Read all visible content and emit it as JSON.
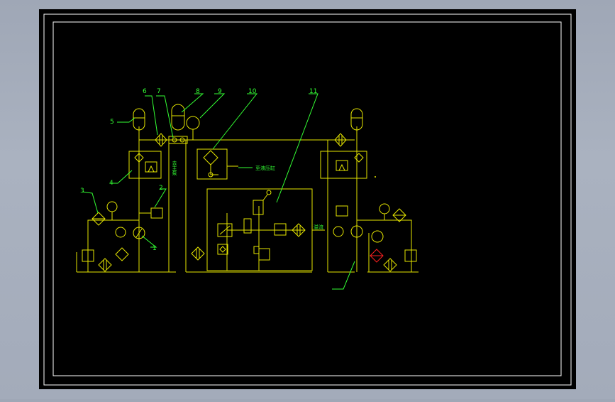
{
  "drawing": {
    "colors": {
      "viewport_bg": "#9fa7b6",
      "paper": "#000000",
      "frame": "#ffffff",
      "line_yellow": "#e6e600",
      "line_green": "#33ff33",
      "annotation": "#33ff33",
      "red_component": "#ff2020"
    },
    "balloon_labels": [
      "1",
      "2",
      "3",
      "4",
      "5",
      "6",
      "7",
      "8",
      "9",
      "10",
      "11"
    ],
    "text_notes": {
      "left_vertical": "去主泵",
      "mid_right": "至液压缸",
      "right_side": "溢流"
    },
    "icons": [
      "accumulator-icon",
      "filter-icon",
      "pressure-gauge-icon",
      "pump-icon",
      "motor-icon",
      "relief-valve-icon",
      "check-valve-icon",
      "cooler-icon",
      "directional-valve-icon",
      "reservoir-icon"
    ]
  }
}
